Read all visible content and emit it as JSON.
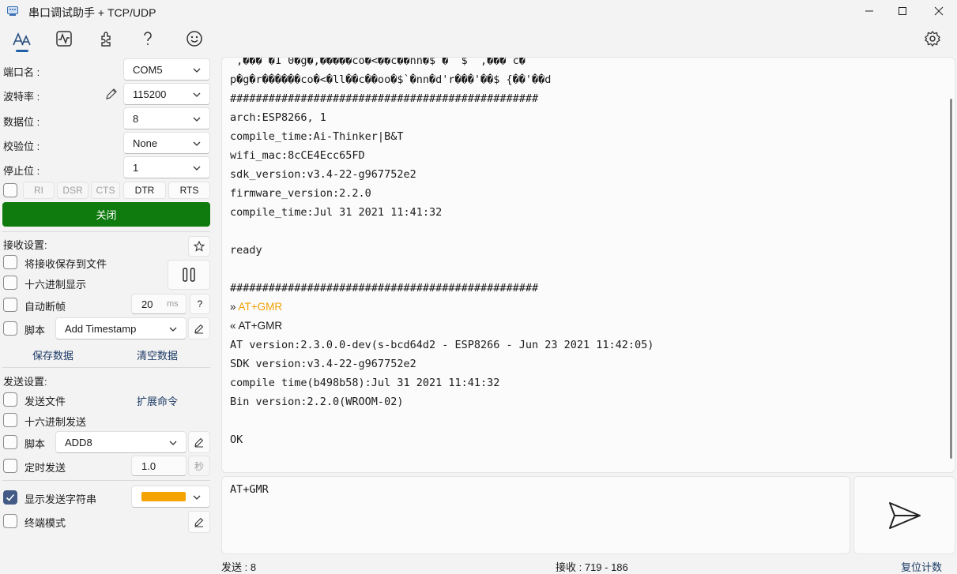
{
  "window": {
    "title": "串口调试助手 + TCP/UDP"
  },
  "toolbar": {
    "icons": [
      "font-icon",
      "waveform-icon",
      "plugin-icon",
      "help-icon",
      "smiley-icon",
      "settings-icon"
    ]
  },
  "serial": {
    "port_label": "端口名 :",
    "port_value": "COM5",
    "baud_label": "波特率 :",
    "baud_value": "115200",
    "databits_label": "数据位 :",
    "databits_value": "8",
    "parity_label": "校验位 :",
    "parity_value": "None",
    "stopbits_label": "停止位 :",
    "stopbits_value": "1",
    "signals": [
      "RI",
      "DSR",
      "CTS",
      "DTR",
      "RTS"
    ],
    "close_label": "关闭"
  },
  "receive": {
    "title": "接收设置:",
    "save_to_file": "将接收保存到文件",
    "hex_display": "十六进制显示",
    "auto_frame": "自动断帧",
    "auto_frame_value": "20",
    "auto_frame_unit": "ms",
    "help": "?",
    "script_label": "脚本",
    "script_value": "Add Timestamp",
    "save_data": "保存数据",
    "clear_data": "清空数据"
  },
  "send": {
    "title": "发送设置:",
    "send_file": "发送文件",
    "ext_cmd": "扩展命令",
    "hex_send": "十六进制发送",
    "script_label": "脚本",
    "script_value": "ADD8",
    "timed_send": "定时发送",
    "timed_value": "1.0",
    "timed_unit": "秒",
    "show_sent": "显示发送字符串",
    "show_sent_color": "#f5a300",
    "terminal_mode": "终端模式",
    "input_value": "AT+GMR"
  },
  "log": {
    "lines": [
      " ,��� �1 0�g�,�����co�<��c��nn�$ �  $  ,��� c�",
      "p�g�r������co�<�ll��c��oo�$`�nn�d'r���'��$ {��'��d",
      "################################################",
      "arch:ESP8266, 1",
      "compile_time:Ai-Thinker|B&T",
      "wifi_mac:8cCE4Ecc65FD",
      "sdk_version:v3.4-22-g967752e2",
      "firmware_version:2.2.0",
      "compile_time:Jul 31 2021 11:41:32",
      "",
      "ready",
      "",
      "################################################",
      "» AT+GMR",
      "« AT+GMR",
      "AT version:2.3.0.0-dev(s-bcd64d2 - ESP8266 - Jun 23 2021 11:42:05)",
      "SDK version:v3.4-22-g967752e2",
      "compile time(b498b58):Jul 31 2021 11:41:32",
      "Bin version:2.2.0(WROOM-02)",
      "",
      "OK"
    ],
    "sent_color": "#f0a000"
  },
  "status": {
    "sent": "发送 : 8",
    "received": "接收 : 719 - 186",
    "reset": "复位计数"
  }
}
